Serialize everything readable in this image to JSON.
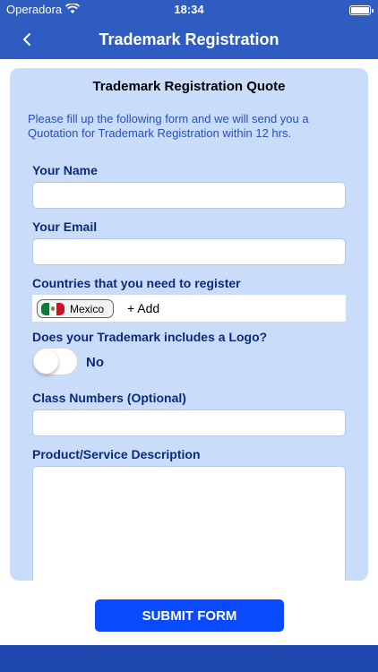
{
  "status_bar": {
    "carrier": "Operadora",
    "time": "18:34"
  },
  "nav": {
    "title": "Trademark Registration"
  },
  "form": {
    "title": "Trademark Registration Quote",
    "intro": "Please fill up the following form and we will send you a Quotation for Trademark Registration within 12 hrs.",
    "name_label": "Your Name",
    "name_value": "",
    "email_label": "Your Email",
    "email_value": "",
    "countries_label": "Countries that you need to register",
    "countries": [
      {
        "name": "Mexico",
        "flag_colors": [
          "#0e7a3a",
          "#ffffff",
          "#ce1126"
        ]
      }
    ],
    "add_country_label": "+ Add",
    "logo_label": "Does your Trademark includes a Logo?",
    "logo_toggle_on": false,
    "logo_toggle_text": "No",
    "class_label": "Class Numbers (Optional)",
    "class_value": "",
    "description_label": "Product/Service Description",
    "description_value": ""
  },
  "submit_label": "SUBMIT FORM",
  "colors": {
    "header": "#2f5cc1",
    "card": "#c9ddfb",
    "label": "#0d2a7a",
    "intro_text": "#2a4fb5",
    "submit": "#0a4aff",
    "bottom_bar": "#1e48ad"
  }
}
